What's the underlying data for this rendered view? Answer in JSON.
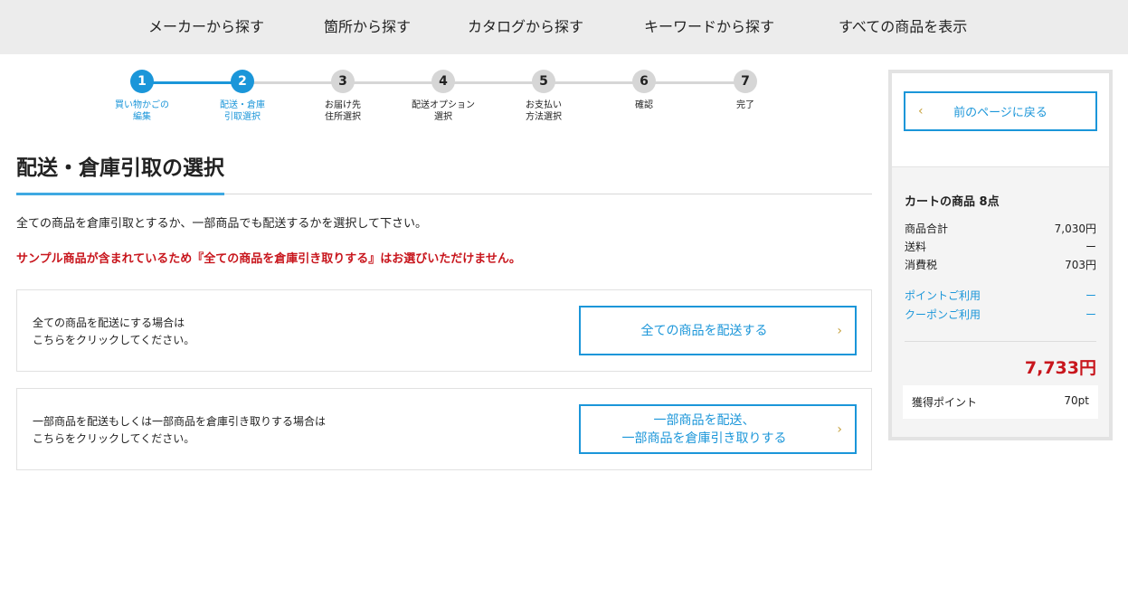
{
  "nav": {
    "items": [
      "メーカーから探す",
      "箇所から探す",
      "カタログから探す",
      "キーワードから探す",
      "すべての商品を表示"
    ]
  },
  "stepper": {
    "steps": [
      {
        "num": "1",
        "label": "買い物かごの\n編集",
        "state": "done"
      },
      {
        "num": "2",
        "label": "配送・倉庫\n引取選択",
        "state": "active"
      },
      {
        "num": "3",
        "label": "お届け先\n住所選択",
        "state": "pending"
      },
      {
        "num": "4",
        "label": "配送オプション\n選択",
        "state": "pending"
      },
      {
        "num": "5",
        "label": "お支払い\n方法選択",
        "state": "pending"
      },
      {
        "num": "6",
        "label": "確認",
        "state": "pending"
      },
      {
        "num": "7",
        "label": "完了",
        "state": "pending"
      }
    ]
  },
  "main": {
    "title": "配送・倉庫引取の選択",
    "intro": "全ての商品を倉庫引取とするか、一部商品でも配送するかを選択して下さい。",
    "warning": "サンプル商品が含まれているため『全ての商品を倉庫引き取りする』はお選びいただけません。",
    "options": [
      {
        "desc_line1": "全ての商品を配送にする場合は",
        "desc_line2": "こちらをクリックしてください。",
        "button_line1": "全ての商品を配送する",
        "button_line2": ""
      },
      {
        "desc_line1": "一部商品を配送もしくは一部商品を倉庫引き取りする場合は",
        "desc_line2": "こちらをクリックしてください。",
        "button_line1": "一部商品を配送、",
        "button_line2": "一部商品を倉庫引き取りする"
      }
    ],
    "chevron": "›"
  },
  "sidebar": {
    "back_label": "前のページに戻る",
    "back_chevron": "‹",
    "cart_title": "カートの商品 8点",
    "rows": [
      {
        "label": "商品合計",
        "value": "7,030円"
      },
      {
        "label": "送料",
        "value": "ー"
      },
      {
        "label": "消費税",
        "value": "703円"
      }
    ],
    "links": [
      {
        "label": "ポイントご利用",
        "value": "ー"
      },
      {
        "label": "クーポンご利用",
        "value": "ー"
      }
    ],
    "total": "7,733円",
    "points_label": "獲得ポイント",
    "points_value": "70pt"
  },
  "colors": {
    "accent": "#1b96d9",
    "warning": "#c8161d",
    "chevron": "#c6a13d",
    "nav_bg": "#ececec"
  }
}
